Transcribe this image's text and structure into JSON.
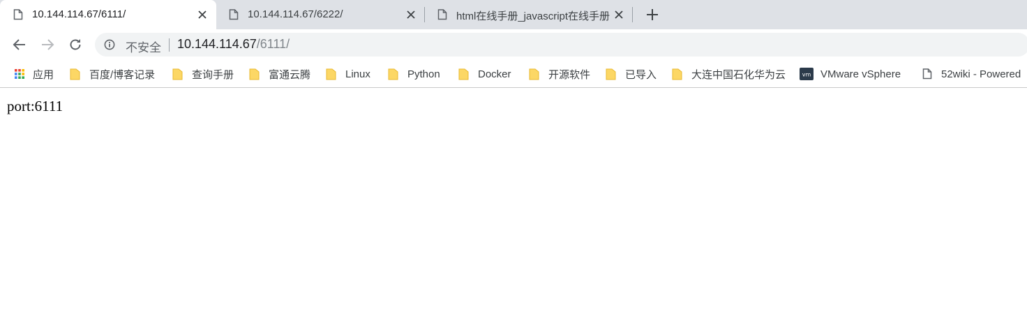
{
  "tabs": [
    {
      "title": "10.144.114.67/6111/",
      "active": true
    },
    {
      "title": "10.144.114.67/6222/",
      "active": false
    },
    {
      "title": "html在线手册_javascript在线手册",
      "active": false
    }
  ],
  "toolbar": {
    "security_label": "不安全",
    "url_host": "10.144.114.67",
    "url_path": "/6111/"
  },
  "bookmarks": [
    {
      "label": "应用",
      "icon": "apps-grid-icon"
    },
    {
      "label": "百度/博客记录",
      "icon": "folder-icon"
    },
    {
      "label": "查询手册",
      "icon": "folder-icon"
    },
    {
      "label": "富通云腾",
      "icon": "folder-icon"
    },
    {
      "label": "Linux",
      "icon": "folder-icon"
    },
    {
      "label": "Python",
      "icon": "folder-icon"
    },
    {
      "label": "Docker",
      "icon": "folder-icon"
    },
    {
      "label": "开源软件",
      "icon": "folder-icon"
    },
    {
      "label": "已导入",
      "icon": "folder-icon"
    },
    {
      "label": "大连中国石化华为云",
      "icon": "folder-icon"
    },
    {
      "label": "VMware vSphere",
      "icon": "vmware-icon"
    },
    {
      "label": "52wiki - Powered",
      "icon": "page-icon"
    }
  ],
  "page": {
    "text": "port:6111"
  },
  "colors": {
    "tabstrip_bg": "#dee1e6",
    "omnibox_bg": "#f1f3f4",
    "folder_yellow": "#fcd765"
  }
}
